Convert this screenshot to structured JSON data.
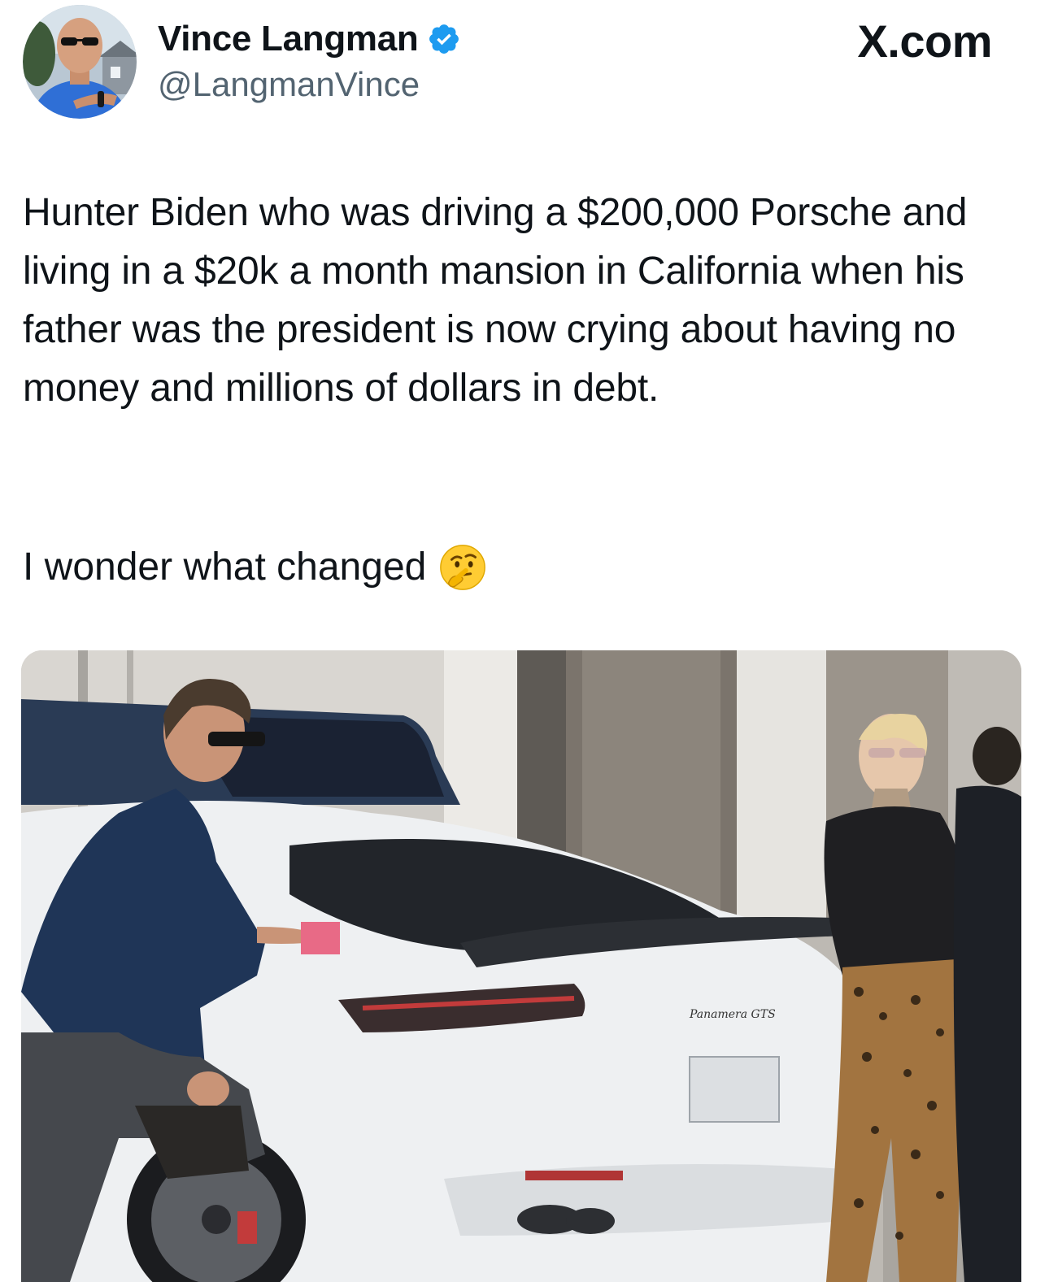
{
  "author": {
    "display_name": "Vince Langman",
    "handle": "@LangmanVince",
    "avatar_icon": "profile-photo",
    "verified_icon": "verified-badge-icon",
    "verified_color": "#1d9bf0"
  },
  "site": {
    "brand": "X.com"
  },
  "tweet": {
    "text": "Hunter Biden who was driving a $200,000 Porsche and living in a $20k a month mansion in California when his father was the president is now crying about having no money and millions of dollars in debt.",
    "text_2": "I wonder what changed",
    "emoji_icon": "thinking-face-emoji"
  },
  "media": {
    "car_badge": "Panamera GTS"
  },
  "colors": {
    "text_primary": "#0f1419",
    "text_secondary": "#536471"
  }
}
